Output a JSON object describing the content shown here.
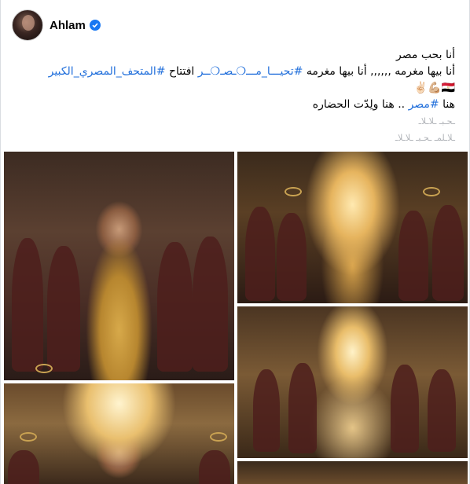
{
  "post": {
    "author": "Ahlam",
    "avatar_icon": "avatar",
    "verified_icon": "verified-badge-icon",
    "lines": {
      "l1": "أنا بحب مصر",
      "l2_prefix": "أنا بيها مغرمه ,,,,,, أنا بيها مغرمه ",
      "l2_tag1": "#تحيـــا_مـــ❍ـصـ❍ــر",
      "l2_mid": " افتتاح ",
      "l2_tag2": "#المتحف_المصري_الكبير",
      "l3": "🇪🇬💪🏼✌🏻",
      "l4_prefix": "هنا ",
      "l4_tag": "#مصر",
      "l4_suffix": " .. هنا ولِدّت الحضاره",
      "l5": "ـحـبـ ـلاـلاـ",
      "l6": "ـلاـلمـ ـحـبـ ـلاـلاـ"
    }
  },
  "photos": [
    {
      "name": "photo-1"
    },
    {
      "name": "photo-2"
    },
    {
      "name": "photo-3"
    },
    {
      "name": "photo-4"
    },
    {
      "name": "photo-5"
    }
  ],
  "colors": {
    "hashtag": "#216fdb",
    "text": "#050505",
    "verified": "#1877f2"
  }
}
